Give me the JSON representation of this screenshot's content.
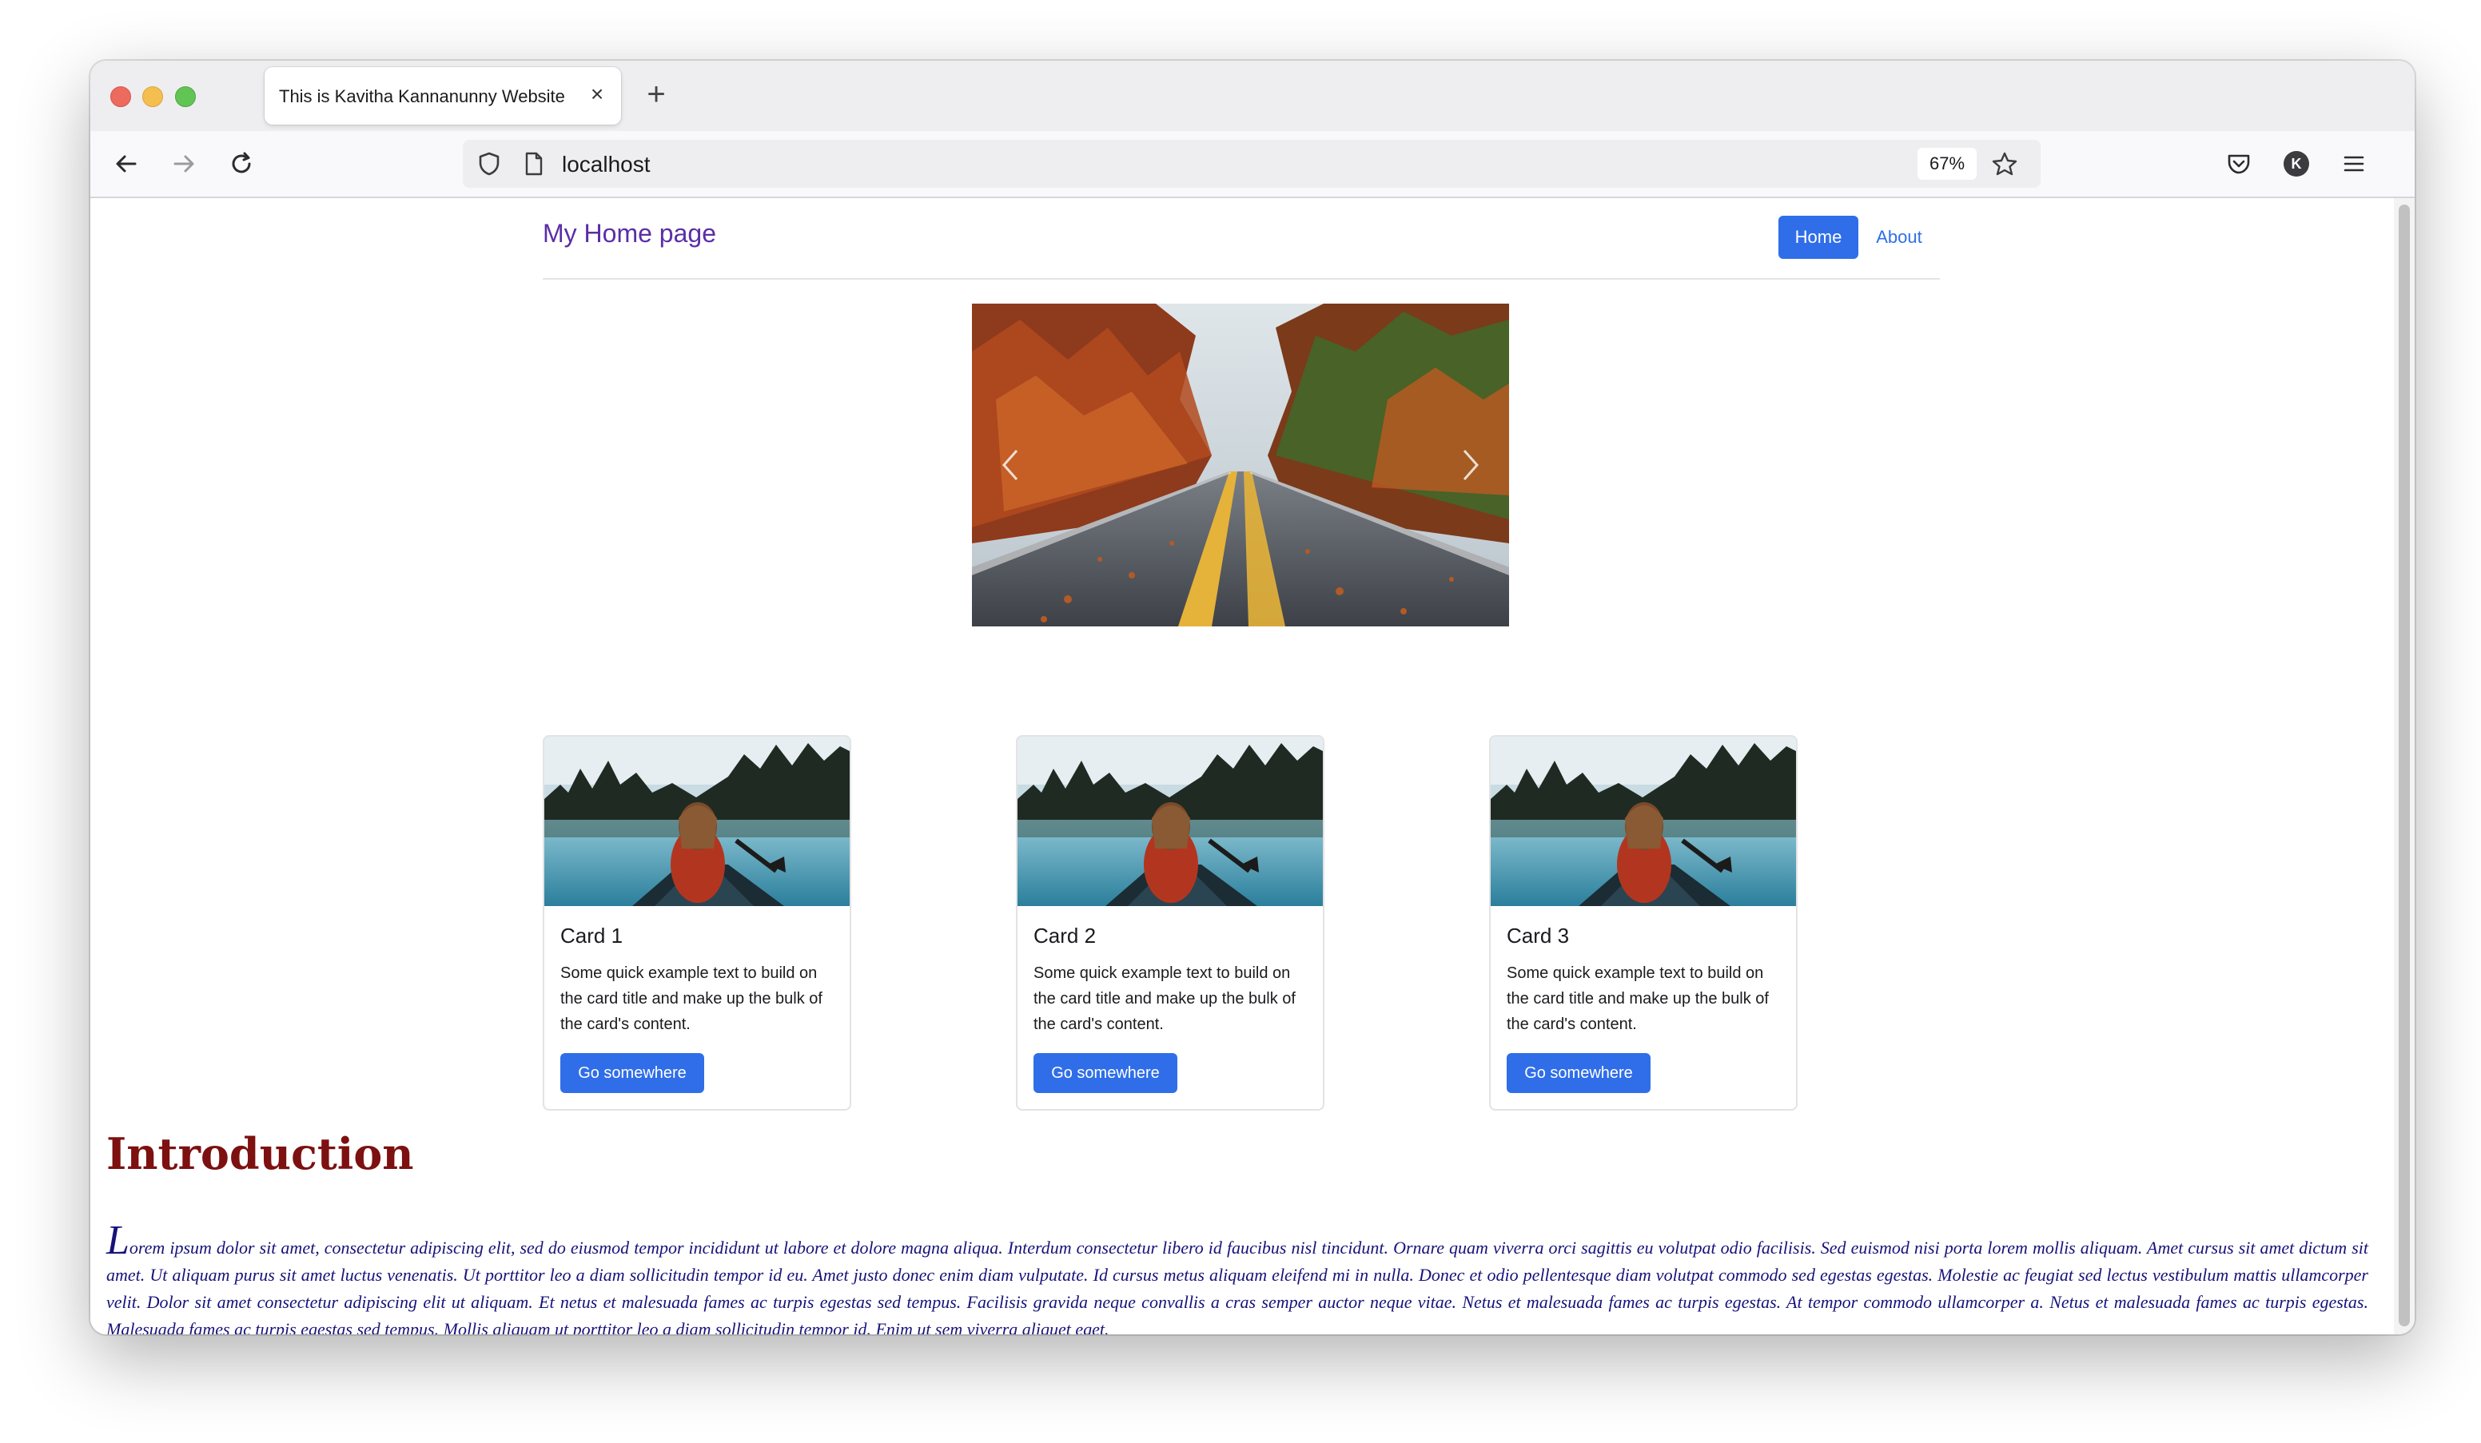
{
  "browser": {
    "tab_title": "This is Kavitha Kannanunny Website",
    "url": "localhost",
    "zoom": "67%",
    "account_initial": "K",
    "icons": [
      "back-arrow-icon",
      "forward-arrow-icon",
      "reload-icon",
      "shield-icon",
      "page-icon",
      "star-icon",
      "pocket-icon",
      "account-icon",
      "hamburger-menu-icon",
      "close-icon",
      "plus-icon"
    ]
  },
  "site": {
    "brand": "My Home page",
    "nav": {
      "home": "Home",
      "about": "About"
    },
    "carousel": {
      "slide_description": "autumn road photo"
    },
    "cards": [
      {
        "title": "Card 1",
        "text": "Some quick example text to build on the card title and make up the bulk of the card's content.",
        "button": "Go somewhere"
      },
      {
        "title": "Card 2",
        "text": "Some quick example text to build on the card title and make up the bulk of the card's content.",
        "button": "Go somewhere"
      },
      {
        "title": "Card 3",
        "text": "Some quick example text to build on the card title and make up the bulk of the card's content.",
        "button": "Go somewhere"
      }
    ],
    "intro": {
      "heading": "Introduction",
      "drop_cap": "L",
      "paragraph": "orem ipsum dolor sit amet, consectetur adipiscing elit, sed do eiusmod tempor incididunt ut labore et dolore magna aliqua. Interdum consectetur libero id faucibus nisl tincidunt. Ornare quam viverra orci sagittis eu volutpat odio facilisis. Sed euismod nisi porta lorem mollis aliquam. Amet cursus sit amet dictum sit amet. Ut aliquam purus sit amet luctus venenatis. Ut porttitor leo a diam sollicitudin tempor id eu. Amet justo donec enim diam vulputate. Id cursus metus aliquam eleifend mi in nulla. Donec et odio pellentesque diam volutpat commodo sed egestas egestas. Molestie ac feugiat sed lectus vestibulum mattis ullamcorper velit. Dolor sit amet consectetur adipiscing elit ut aliquam. Et netus et malesuada fames ac turpis egestas sed tempus. Facilisis gravida neque convallis a cras semper auctor neque vitae. Netus et malesuada fames ac turpis egestas. At tempor commodo ullamcorper a. Netus et malesuada fames ac turpis egestas. Malesuada fames ac turpis egestas sed tempus. Mollis aliquam ut porttitor leo a diam sollicitudin tempor id. Enim ut sem viverra aliquet eget."
    }
  },
  "colors": {
    "accent": "#2f6ee8",
    "brand": "#5b2ea6",
    "heading": "#7d1010",
    "paragraph": "#16137a"
  }
}
